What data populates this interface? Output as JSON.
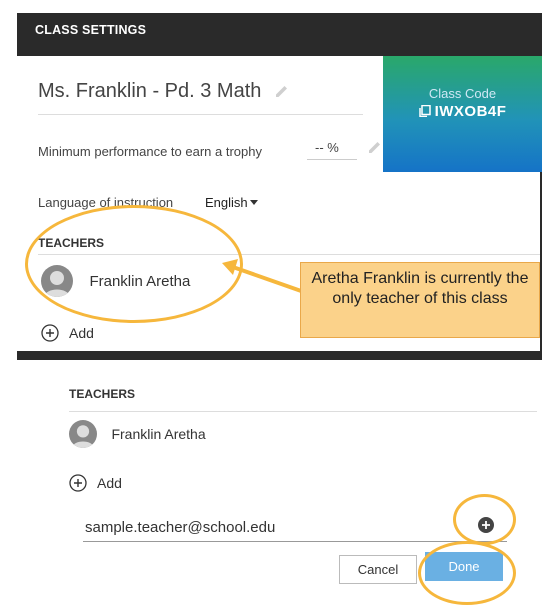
{
  "panel": {
    "title": "CLASS SETTINGS"
  },
  "class": {
    "name": "Ms. Franklin - Pd. 3 Math",
    "code_label": "Class Code",
    "code_value": "IWXOB4F"
  },
  "settings": {
    "min_performance_label": "Minimum performance to earn a trophy",
    "min_performance_value": "-- %",
    "language_label": "Language of instruction",
    "language_value": "English"
  },
  "teachers_section": {
    "heading": "TEACHERS",
    "teachers": [
      "Franklin Aretha"
    ],
    "add_label": "Add"
  },
  "callout": {
    "text": "Aretha Franklin is currently the only teacher of this class"
  },
  "add_teacher_form": {
    "heading": "TEACHERS",
    "teacher_name": "Franklin Aretha",
    "add_label": "Add",
    "email_value": "sample.teacher@school.edu",
    "cancel_label": "Cancel",
    "done_label": "Done"
  },
  "colors": {
    "panel_bg": "#2a2a2a",
    "highlight": "#f6b73c",
    "callout_bg": "#fbd28a",
    "done_button": "#6ab0e3"
  }
}
